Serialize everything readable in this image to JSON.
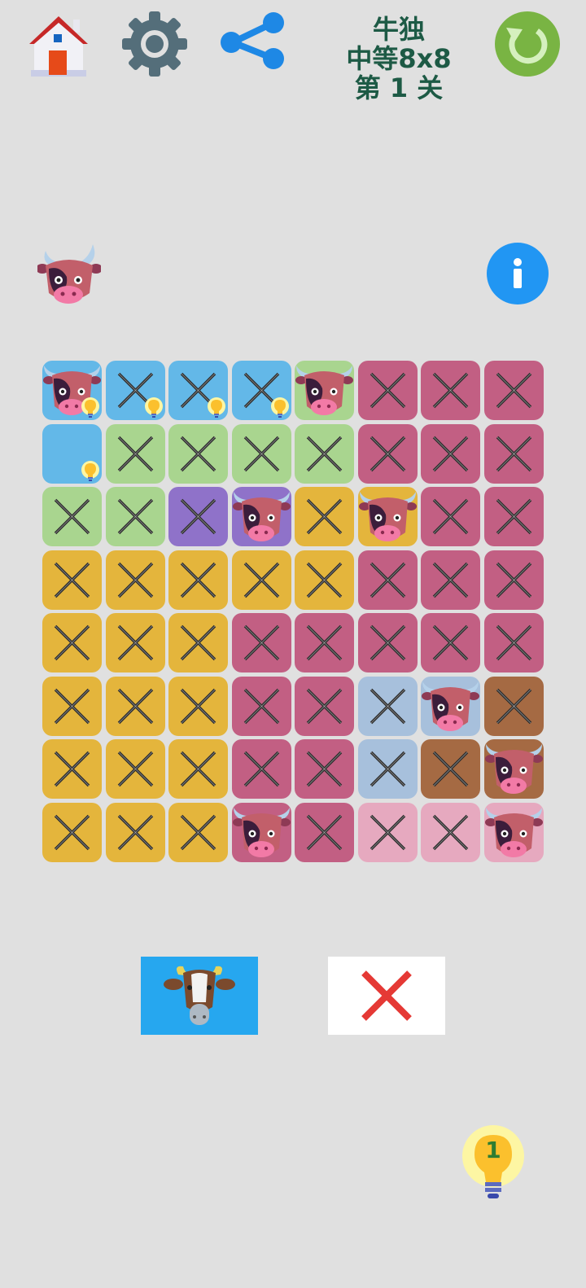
{
  "title": {
    "line1": "牛独",
    "line2": "中等8x8",
    "line3": "第 1 关"
  },
  "icons": {
    "home": "home-icon",
    "settings": "gear-icon",
    "share": "share-icon",
    "refresh": "refresh-icon",
    "info": "info-icon",
    "hint": "lightbulb-icon"
  },
  "hint_count": "1",
  "info_label": "i",
  "colors": {
    "background": "#e0e0e0",
    "blue": "#63b8e8",
    "green": "#a9d58f",
    "purple": "#8f72c9",
    "yellow": "#e4b53c",
    "magenta": "#c25f83",
    "steel": "#a7c0dc",
    "brown": "#a56a43",
    "pink": "#e6a9bf",
    "title": "#1d5a45",
    "refresh": "#79b443",
    "info": "#2196f3",
    "mode_cow_bg": "#26a7ef",
    "mode_x_color": "#e53935"
  },
  "board": {
    "regions": [
      [
        "blue",
        "blue",
        "blue",
        "blue",
        "green",
        "magenta",
        "magenta",
        "magenta"
      ],
      [
        "blue",
        "green",
        "green",
        "green",
        "green",
        "magenta",
        "magenta",
        "magenta"
      ],
      [
        "green",
        "green",
        "purple",
        "purple",
        "yellow",
        "yellow",
        "magenta",
        "magenta"
      ],
      [
        "yellow",
        "yellow",
        "yellow",
        "yellow",
        "yellow",
        "magenta",
        "magenta",
        "magenta"
      ],
      [
        "yellow",
        "yellow",
        "yellow",
        "magenta",
        "magenta",
        "magenta",
        "magenta",
        "magenta"
      ],
      [
        "yellow",
        "yellow",
        "yellow",
        "magenta",
        "magenta",
        "steel",
        "steel",
        "brown"
      ],
      [
        "yellow",
        "yellow",
        "yellow",
        "magenta",
        "magenta",
        "steel",
        "brown",
        "brown"
      ],
      [
        "yellow",
        "yellow",
        "yellow",
        "magenta",
        "magenta",
        "pink",
        "pink",
        "pink"
      ]
    ],
    "marks": [
      [
        "cow",
        "x",
        "x",
        "x",
        "cow",
        "x",
        "x",
        "x"
      ],
      [
        "empty",
        "x",
        "x",
        "x",
        "x",
        "x",
        "x",
        "x"
      ],
      [
        "x",
        "x",
        "x",
        "cow",
        "x",
        "cow",
        "x",
        "x"
      ],
      [
        "x",
        "x",
        "x",
        "x",
        "x",
        "x",
        "x",
        "x"
      ],
      [
        "x",
        "x",
        "x",
        "x",
        "x",
        "x",
        "x",
        "x"
      ],
      [
        "x",
        "x",
        "x",
        "x",
        "x",
        "x",
        "cow",
        "x"
      ],
      [
        "x",
        "x",
        "x",
        "x",
        "x",
        "x",
        "x",
        "cow"
      ],
      [
        "x",
        "x",
        "x",
        "cow",
        "x",
        "x",
        "x",
        "cow"
      ]
    ],
    "hinted": [
      [
        true,
        true,
        true,
        true,
        false,
        false,
        false,
        false
      ],
      [
        true,
        false,
        false,
        false,
        false,
        false,
        false,
        false
      ],
      [
        false,
        false,
        false,
        false,
        false,
        false,
        false,
        false
      ],
      [
        false,
        false,
        false,
        false,
        false,
        false,
        false,
        false
      ],
      [
        false,
        false,
        false,
        false,
        false,
        false,
        false,
        false
      ],
      [
        false,
        false,
        false,
        false,
        false,
        false,
        false,
        false
      ],
      [
        false,
        false,
        false,
        false,
        false,
        false,
        false,
        false
      ],
      [
        false,
        false,
        false,
        false,
        false,
        false,
        false,
        false
      ]
    ]
  }
}
